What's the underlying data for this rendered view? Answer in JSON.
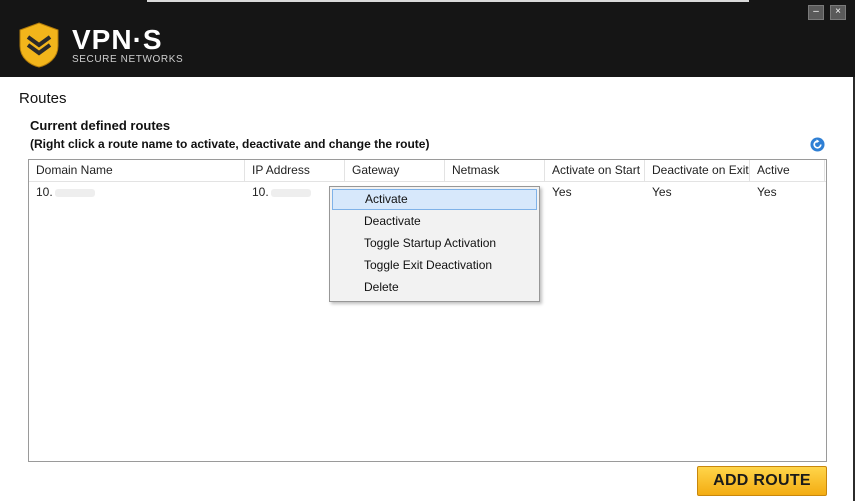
{
  "header": {
    "brand": "VPN·S",
    "tagline": "SECURE NETWORKS",
    "minimize_glyph": "–",
    "close_glyph": "×",
    "icons": {
      "logo": "shield-logo-icon",
      "refresh": "refresh-icon"
    }
  },
  "page": {
    "title": "Routes",
    "section_title": "Current defined routes",
    "section_hint": "(Right click a route name to activate, deactivate and change the route)"
  },
  "table": {
    "columns": [
      "Domain Name",
      "IP Address",
      "Gateway",
      "Netmask",
      "Activate on Start",
      "Deactivate on Exit",
      "Active"
    ],
    "rows": [
      {
        "domain": "10.",
        "ip": "10.",
        "gateway": "",
        "netmask": "",
        "activate_on_start": "Yes",
        "deactivate_on_exit": "Yes",
        "active": "Yes"
      }
    ]
  },
  "context_menu": {
    "items": [
      "Activate",
      "Deactivate",
      "Toggle Startup Activation",
      "Toggle Exit Deactivation",
      "Delete"
    ],
    "highlighted": "Activate"
  },
  "actions": {
    "add_route": "ADD ROUTE"
  },
  "colors": {
    "header_bg": "#151515",
    "accent": "#f3ac12",
    "menu_highlight": "#d7e8fb"
  }
}
